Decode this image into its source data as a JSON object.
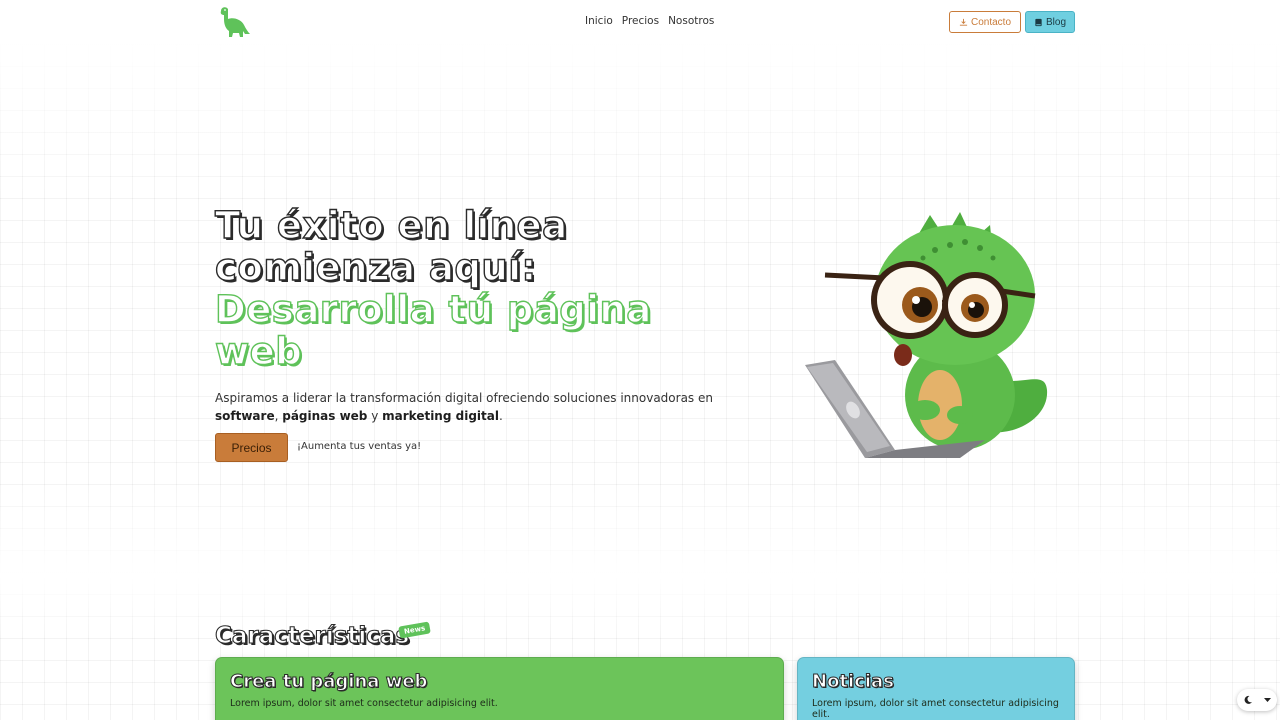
{
  "nav": {
    "links": [
      "Inicio",
      "Precios",
      "Nosotros"
    ],
    "contact_label": "Contacto",
    "blog_label": "Blog"
  },
  "hero": {
    "title_line1": "Tu éxito en línea",
    "title_line2": "comienza aquí:",
    "title_line3": "Desarrolla tú página",
    "title_line4": "web",
    "desc_prefix": "Aspiramos a liderar la transformación digital ofreciendo soluciones innovadoras en ",
    "desc_software": "software",
    "desc_sep1": ", ",
    "desc_web": "páginas web",
    "desc_sep2": " y ",
    "desc_marketing": "marketing digital",
    "desc_end": ".",
    "cta_button": "Precios",
    "cta_text": "¡Aumenta tus ventas ya!"
  },
  "features": {
    "title": "Características",
    "badge": "News",
    "cards": [
      {
        "title": "Crea tu página web",
        "text": "Lorem ipsum, dolor sit amet consectetur adipisicing elit."
      },
      {
        "title": "Noticias",
        "text": "Lorem ipsum, dolor sit amet consectetur adipisicing elit."
      }
    ]
  },
  "colors": {
    "brand_green": "#5fc25a",
    "accent_orange": "#c97c3a",
    "accent_blue": "#6fcfe0"
  },
  "icons": {
    "logo": "dinosaur-logo",
    "contact": "download-icon",
    "blog": "book-icon",
    "theme": "moon-icon",
    "dropdown": "caret-down-icon"
  }
}
